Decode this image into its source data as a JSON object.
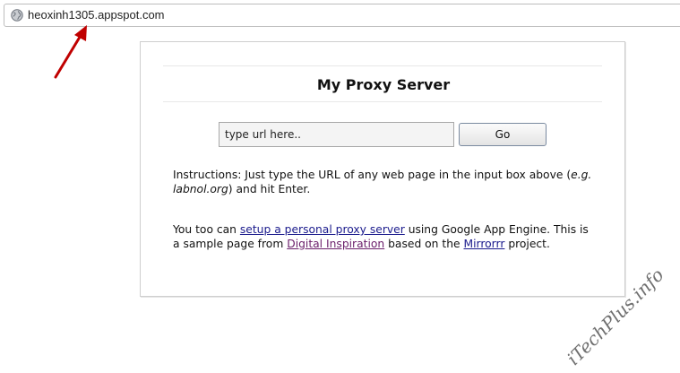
{
  "browser": {
    "url": "heoxinh1305.appspot.com",
    "globe_icon": "globe-icon"
  },
  "proxy": {
    "title": "My Proxy Server",
    "input_value": "type url here..",
    "go_label": "Go",
    "instructions": {
      "pre": "Instructions: Just type the URL of any web page in the input box above (",
      "example": "e.g. labnol.org",
      "post": ") and hit Enter."
    },
    "about": {
      "t1": "You too can ",
      "link1": "setup a personal proxy server",
      "t2": " using Google App Engine. This is a sample page from ",
      "link2": "Digital Inspiration",
      "t3": " based on the ",
      "link3": "Mirrorrr",
      "t4": " project."
    }
  },
  "watermark": "iTechPlus.info",
  "colors": {
    "arrow": "#c00000",
    "link": "#1a1a8c",
    "visited_link": "#6b1f6b"
  }
}
